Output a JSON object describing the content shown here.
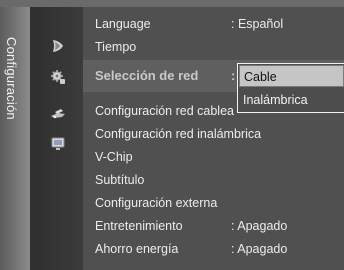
{
  "side_title": "Configuración",
  "menu": {
    "items": [
      {
        "label": "Language",
        "value": ": Español"
      },
      {
        "label": "Tiempo",
        "value": ""
      },
      {
        "label": "Selección de red",
        "value": ":"
      },
      {
        "label": "Configuración red cablea",
        "value": ""
      },
      {
        "label": "Configuración red inalámbrica",
        "value": ""
      },
      {
        "label": "V-Chip",
        "value": ""
      },
      {
        "label": "Subtítulo",
        "value": ""
      },
      {
        "label": "Configuración externa",
        "value": ""
      },
      {
        "label": "Entretenimiento",
        "value": ": Apagado"
      },
      {
        "label": "Ahorro energía",
        "value": ": Apagado"
      }
    ]
  },
  "dropdown": {
    "selected": "Cable",
    "other": "Inalámbrica"
  },
  "icons": {
    "picture": "picture-icon",
    "setup": "setup-icon",
    "input": "input-icon",
    "channel": "channel-icon"
  },
  "colors": {
    "background": "#3a3a3a",
    "panel": "#505050",
    "text": "#ececec",
    "selected_bg": "#c5c5c5"
  }
}
